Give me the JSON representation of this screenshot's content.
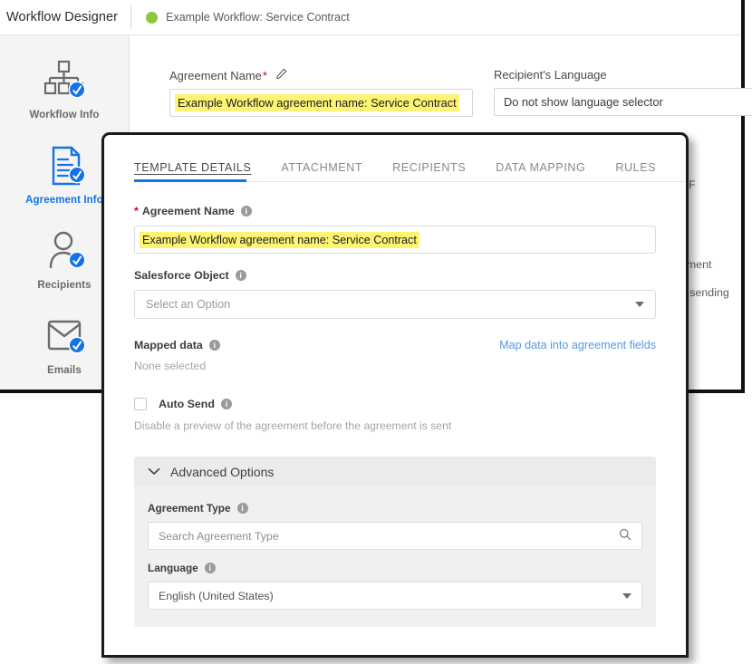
{
  "header": {
    "app_title": "Workflow Designer",
    "workflow_name": "Example Workflow: Service Contract",
    "status_color": "#8dc63f",
    "status_icon": "green-status-dot"
  },
  "sidebar": {
    "items": [
      {
        "label": "Workflow Info",
        "icon": "workflow-info-icon",
        "active": false
      },
      {
        "label": "Agreement Info",
        "icon": "agreement-info-icon",
        "active": true
      },
      {
        "label": "Recipients",
        "icon": "recipients-icon",
        "active": false
      },
      {
        "label": "Emails",
        "icon": "emails-icon",
        "active": false
      }
    ]
  },
  "background_page": {
    "agreement_name_label": "Agreement Name",
    "required_marker": "*",
    "edit_icon": "pencil-icon",
    "agreement_name_value": "Example Workflow agreement name: Service Contract",
    "recipients_language_label": "Recipient's Language",
    "recipients_language_value": "Do not show language selector",
    "clipped_texts": [
      "DF",
      "ement",
      "o sending"
    ]
  },
  "modal": {
    "tabs": [
      {
        "label": "TEMPLATE DETAILS",
        "active": true
      },
      {
        "label": "ATTACHMENT",
        "active": false
      },
      {
        "label": "RECIPIENTS",
        "active": false
      },
      {
        "label": "DATA MAPPING",
        "active": false
      },
      {
        "label": "RULES",
        "active": false
      }
    ],
    "active_tab_color": "#1473e6",
    "agreement_name": {
      "label": "Agreement Name",
      "required_marker": "*",
      "info_icon": "info-icon",
      "value": "Example Workflow agreement name: Service Contract",
      "highlight_color": "#fdf474"
    },
    "salesforce_object": {
      "label": "Salesforce Object",
      "info_icon": "info-icon",
      "placeholder": "Select an Option",
      "dropdown_icon": "chevron-down-icon"
    },
    "mapped_data": {
      "label": "Mapped data",
      "info_icon": "info-icon",
      "link_label": "Map data into agreement fields",
      "link_color": "#5699e0",
      "value": "None selected"
    },
    "auto_send": {
      "label": "Auto Send",
      "info_icon": "info-icon",
      "checked": false,
      "description": "Disable a preview of the agreement before the agreement is sent"
    },
    "advanced_options": {
      "title": "Advanced Options",
      "expanded": true,
      "chevron_icon": "chevron-down-icon",
      "agreement_type": {
        "label": "Agreement Type",
        "info_icon": "info-icon",
        "placeholder": "Search Agreement Type",
        "search_icon": "search-icon"
      },
      "language": {
        "label": "Language",
        "info_icon": "info-icon",
        "value": "English (United States)",
        "dropdown_icon": "chevron-down-icon"
      }
    }
  }
}
